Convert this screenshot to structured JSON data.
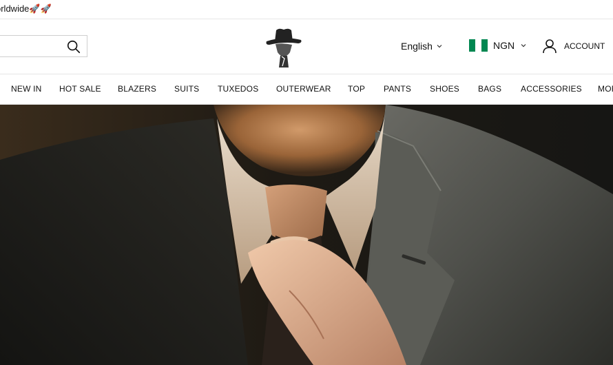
{
  "announcement": {
    "text": "orldwide🚀🚀"
  },
  "search": {
    "placeholder": "",
    "icon": "search-icon"
  },
  "logo": {
    "icon": "hat-figure-logo"
  },
  "language": {
    "label": "English",
    "icon": "chevron-down-icon"
  },
  "currency": {
    "code": "NGN",
    "flag": "nigeria-flag",
    "flag_colors": [
      "#008751",
      "#ffffff",
      "#008751"
    ]
  },
  "account": {
    "label": "ACCOUNT",
    "icon": "user-icon"
  },
  "nav": {
    "items": [
      "NEW IN",
      "HOT SALE",
      "BLAZERS",
      "SUITS",
      "TUXEDOS",
      "OUTERWEAR",
      "TOP",
      "PANTS",
      "SHOES",
      "BAGS",
      "ACCESSORIES",
      "MORE"
    ]
  },
  "hero": {
    "description": "man adjusting tie in grey suit"
  }
}
